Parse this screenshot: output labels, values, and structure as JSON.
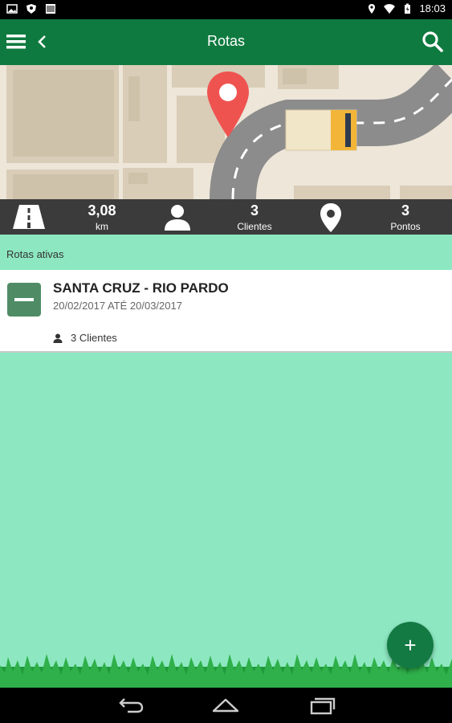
{
  "status_bar": {
    "time": "18:03",
    "left_icons": [
      "image-icon",
      "shield-icon",
      "barcode-icon"
    ],
    "right_icons": [
      "location-icon",
      "wifi-icon",
      "battery-icon"
    ]
  },
  "app_bar": {
    "title": "Rotas",
    "icons": [
      "menu-icon",
      "back-icon",
      "search-icon"
    ]
  },
  "stats": {
    "distance": {
      "value": "3,08",
      "label": "km",
      "icon": "road-icon"
    },
    "clients": {
      "value": "3",
      "label": "Clientes",
      "icon": "person-icon"
    },
    "points": {
      "value": "3",
      "label": "Pontos",
      "icon": "location-pin-icon"
    }
  },
  "section": {
    "title": "Rotas ativas"
  },
  "route_card": {
    "name": "SANTA CRUZ - RIO PARDO",
    "dates": "20/02/2017 ATÉ 20/03/2017",
    "clients": "3 Clientes",
    "toggle_icon": "minus-icon",
    "clients_icon": "person-icon"
  },
  "fab": {
    "label": "+"
  },
  "nav_bar": {
    "icons": [
      "back-nav-icon",
      "home-nav-icon",
      "recents-nav-icon"
    ]
  },
  "colors": {
    "primary": "#0f7a3f",
    "background": "#8de8c1",
    "stats_bar": "#3b3b3b",
    "pin": "#ef5350",
    "minus_button": "#4f8c66"
  }
}
